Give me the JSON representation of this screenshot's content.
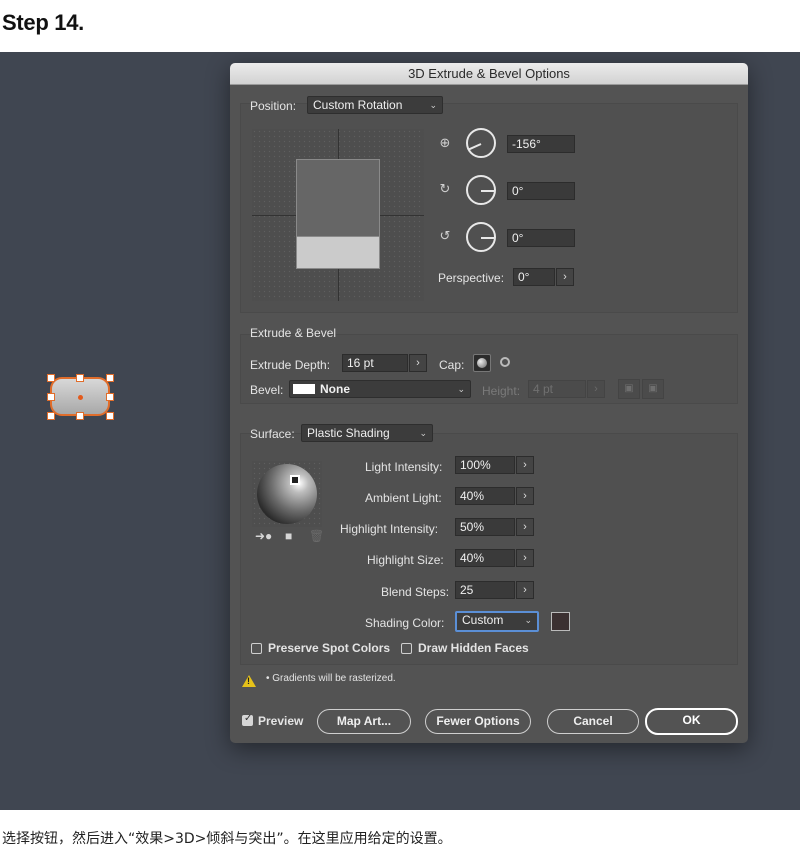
{
  "step_title": "Step 14.",
  "caption": "选择按钮，然后进入“效果>3D>倾斜与突出”。在这里应用给定的设置。",
  "dialog": {
    "title": "3D Extrude & Bevel Options",
    "position": {
      "label": "Position:",
      "value": "Custom Rotation",
      "x_rotation": "-156°",
      "y_rotation": "0°",
      "z_rotation": "0°",
      "perspective_label": "Perspective:",
      "perspective_value": "0°"
    },
    "extrude": {
      "section_label": "Extrude & Bevel",
      "depth_label": "Extrude Depth:",
      "depth_value": "16 pt",
      "cap_label": "Cap:",
      "bevel_label": "Bevel:",
      "bevel_value": "None",
      "height_label": "Height:",
      "height_value": "4 pt"
    },
    "surface": {
      "label": "Surface:",
      "value": "Plastic Shading",
      "light_intensity_label": "Light Intensity:",
      "light_intensity_value": "100%",
      "ambient_light_label": "Ambient Light:",
      "ambient_light_value": "40%",
      "highlight_intensity_label": "Highlight Intensity:",
      "highlight_intensity_value": "50%",
      "highlight_size_label": "Highlight Size:",
      "highlight_size_value": "40%",
      "blend_steps_label": "Blend Steps:",
      "blend_steps_value": "25",
      "shading_color_label": "Shading Color:",
      "shading_color_value": "Custom",
      "shading_color_hex": "#3b3031"
    },
    "options": {
      "preserve_spot_colors": "Preserve Spot Colors",
      "draw_hidden_faces": "Draw Hidden Faces"
    },
    "warning": "• Gradients will be rasterized.",
    "footer": {
      "preview": "Preview",
      "map_art": "Map Art...",
      "fewer_options": "Fewer Options",
      "cancel": "Cancel",
      "ok": "OK"
    }
  },
  "colors": {
    "canvas": "#404651",
    "dialog": "#535353",
    "selection": "#e06d2b"
  }
}
